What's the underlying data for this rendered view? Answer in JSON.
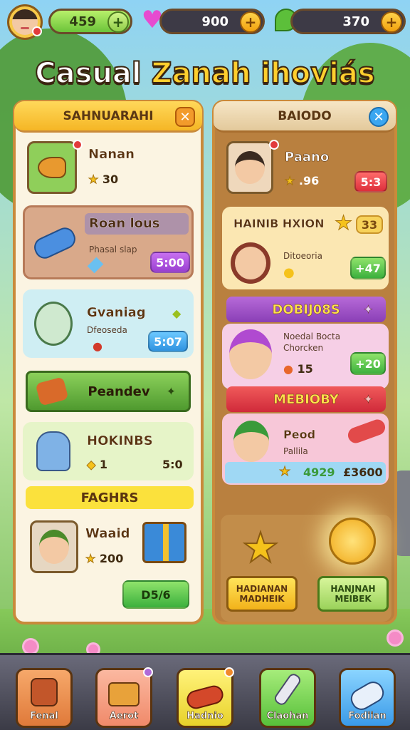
{
  "topbar": {
    "coins": "459",
    "gems": "900",
    "leaves": "370",
    "plus": "+"
  },
  "title": {
    "part1": "Casual ",
    "part2": "Zanah ihoviás"
  },
  "left_panel": {
    "header": "SAHNUARAHI",
    "close": "✕",
    "items": [
      {
        "name": "Nanan",
        "value": "30",
        "price": ""
      },
      {
        "name": "Roan lous",
        "sub": "Phasal slap",
        "price": "5:00"
      },
      {
        "name": "Gvaniag",
        "sub": "Dfeoseda",
        "price": "5:07"
      },
      {
        "name": "Peandev"
      },
      {
        "name": "HOKINBS",
        "value": "1",
        "price": "5:0"
      },
      {
        "name": "FAGHRS"
      },
      {
        "name": "Waaid",
        "value": "200",
        "button": "D5/6"
      }
    ]
  },
  "right_panel": {
    "header": "BAIODO",
    "close": "✕",
    "profile": {
      "name": "Paano",
      "value": ".96",
      "price": "5:3"
    },
    "section1": {
      "title": "HAINIB HXION",
      "badge": "33"
    },
    "card1": {
      "sub": "Ditoeoria",
      "price": "+47"
    },
    "section2": {
      "title": "DOBIJ08S"
    },
    "card2": {
      "sub": "Noedal Bocta Chorcken",
      "value": "15",
      "price": "+20"
    },
    "section3": {
      "title": "MEBIOBY"
    },
    "card3": {
      "name": "Peod",
      "sub": "Pallila",
      "stat1": "4929",
      "stat2": "£3600"
    },
    "reward1": "HADIANAN MADHEIK",
    "reward2": "HANJNAH MEIBEK"
  },
  "tabs": [
    {
      "label": "Fenal",
      "icon": "backpack-icon"
    },
    {
      "label": "Aerot",
      "icon": "chest-icon"
    },
    {
      "label": "Hadnio",
      "icon": "candy-icon"
    },
    {
      "label": "Claohan",
      "icon": "brush-icon"
    },
    {
      "label": "Fodiian",
      "icon": "scroll-icon"
    }
  ]
}
